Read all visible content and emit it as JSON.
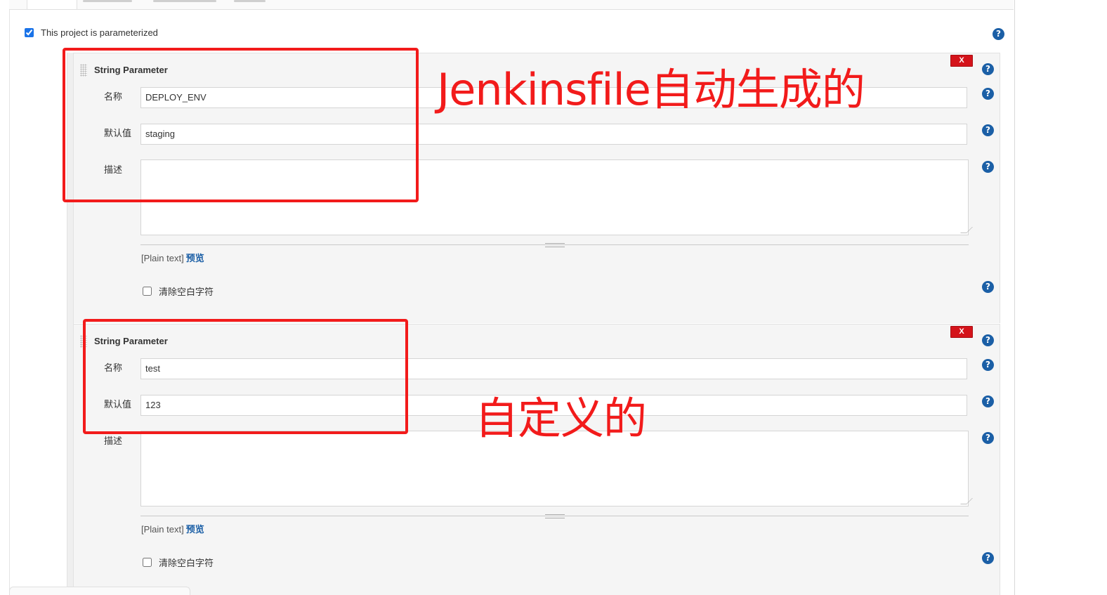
{
  "parameterized": {
    "label": "This project is parameterized",
    "checked": true
  },
  "params": [
    {
      "type_label": "String Parameter",
      "delete_label": "X",
      "name_label": "名称",
      "name_value": "DEPLOY_ENV",
      "default_label": "默认值",
      "default_value": "staging",
      "desc_label": "描述",
      "desc_value": "",
      "plain_text": "[Plain text]",
      "preview_link": "预览",
      "trim_label": "清除空白字符",
      "trim_checked": false
    },
    {
      "type_label": "String Parameter",
      "delete_label": "X",
      "name_label": "名称",
      "name_value": "test",
      "default_label": "默认值",
      "default_value": "123",
      "desc_label": "描述",
      "desc_value": "",
      "plain_text": "[Plain text]",
      "preview_link": "预览",
      "trim_label": "清除空白字符",
      "trim_checked": false
    }
  ],
  "help_glyph": "?",
  "annotations": {
    "first": "Jenkinsfile自动生成的",
    "second": "自定义的"
  },
  "colors": {
    "annotation_red": "#f21b1b",
    "help_blue": "#1b5fa6",
    "delete_red": "#d4131a"
  },
  "icons": [
    "help-icon",
    "delete-icon",
    "drag-grip-icon",
    "resize-handle-icon"
  ]
}
